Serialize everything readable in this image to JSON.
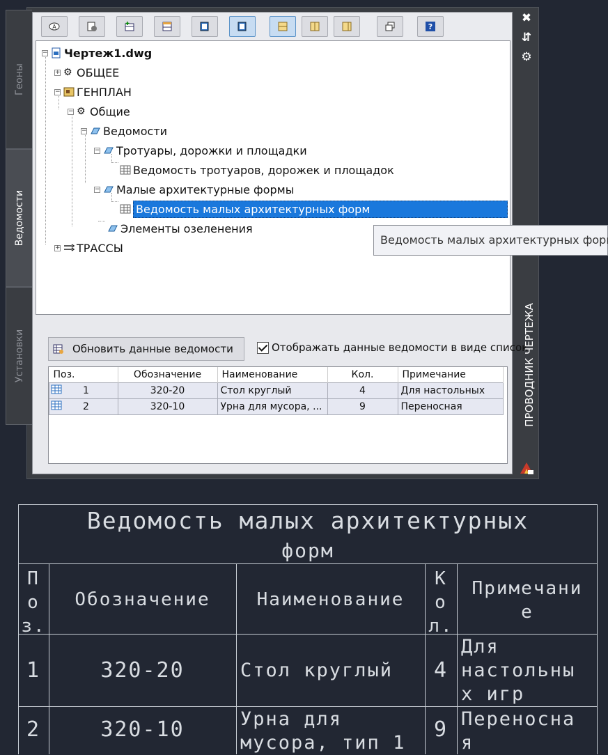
{
  "side_tabs": [
    {
      "label": "Геоны"
    },
    {
      "label": "Ведомости"
    },
    {
      "label": "Установки"
    }
  ],
  "palette_title": "ПРОВОДНИК ЧЕРТЕЖА",
  "window_controls": {
    "close": "✖",
    "autohide": "⇵",
    "properties": "⚙"
  },
  "toolbar": {
    "buttons": [
      {
        "icon": "attribute-icon"
      },
      {
        "icon": "settings-icon"
      },
      {
        "icon": "insert-table-icon"
      },
      {
        "icon": "edit-table-icon"
      },
      {
        "icon": "add-page-icon"
      },
      {
        "icon": "add-page-active-icon"
      },
      {
        "icon": "view-mode-icon"
      },
      {
        "icon": "columns-icon"
      },
      {
        "icon": "columns-alt-icon"
      },
      {
        "icon": "windows-icon"
      },
      {
        "icon": "help-icon"
      }
    ]
  },
  "tree": {
    "root": "Чертеж1.dwg",
    "general": "ОБЩЕЕ",
    "genplan": "ГЕНПЛАН",
    "common": "Общие",
    "registers": "Ведомости",
    "paths": "Тротуары, дорожки и площадки",
    "paths_register": "Ведомость тротуаров, дорожек и площадок",
    "small_forms": "Малые архитектурные формы",
    "small_forms_register": "Ведомость малых архитектурных форм",
    "greenery": "Элементы озеленения",
    "routes": "ТРАССЫ"
  },
  "tooltip": "Ведомость малых архитектурных форм",
  "bottom": {
    "update_button": "Обновить данные ведомости",
    "show_as_list_label": "Отображать данные ведомости в виде список",
    "show_as_list_checked": true
  },
  "grid": {
    "headers": [
      "Поз.",
      "Обозначение",
      "Наименование",
      "Кол.",
      "Примечание"
    ],
    "rows": [
      [
        "1",
        "320-20",
        "Стол круглый",
        "4",
        "Для настольных"
      ],
      [
        "2",
        "320-10",
        "Урна для мусора, ...",
        "9",
        "Переносная"
      ]
    ]
  },
  "cad_table": {
    "title_line1": "Ведомость малых архитектурных",
    "title_line2": "форм",
    "head_pos": [
      "П",
      "о",
      "з."
    ],
    "head_designation": "Обозначение",
    "head_name": "Наименование",
    "head_qty": [
      "К",
      "о",
      "л."
    ],
    "head_note": [
      "Примечани",
      "е"
    ],
    "rows": [
      {
        "pos": "1",
        "designation": "320-20",
        "name": [
          "Стол круглый"
        ],
        "qty": "4",
        "note": [
          "Для",
          "настольны",
          "х игр"
        ]
      },
      {
        "pos": "2",
        "designation": "320-10",
        "name": [
          "Урна для",
          "мусора, тип 1"
        ],
        "qty": "9",
        "note": [
          "Переносна",
          "я"
        ]
      }
    ]
  },
  "colors": {
    "selection": "#1a78dc",
    "background": "#222733",
    "panel": "#3a3d42"
  }
}
